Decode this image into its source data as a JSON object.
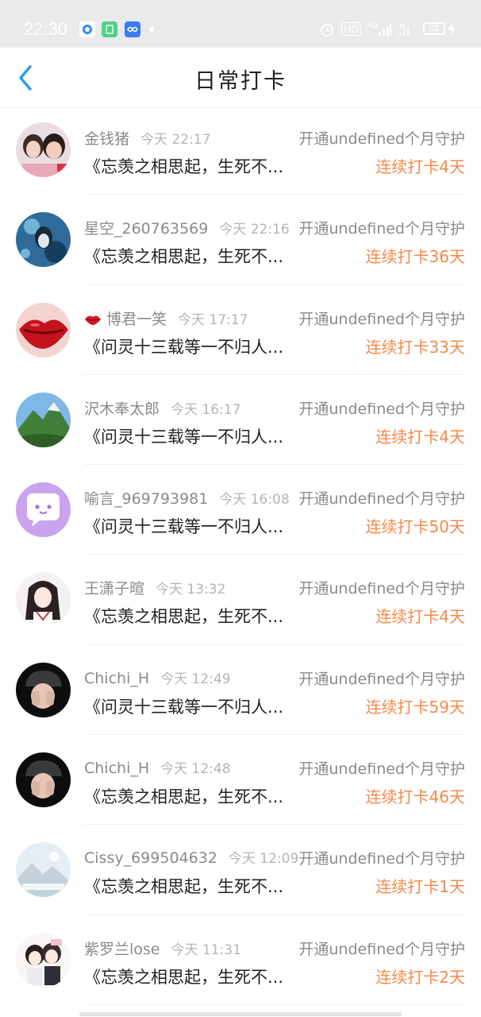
{
  "status_bar": {
    "time": "22:30",
    "hd_label": "HD",
    "network_label": "4G",
    "battery": "52"
  },
  "header": {
    "title": "日常打卡"
  },
  "colors": {
    "accent": "#2f9bf0",
    "streak": "#f5894a",
    "muted_text": "#8a8a8a"
  },
  "entries": [
    {
      "name": "金钱猪",
      "time": "今天 22:17",
      "guard": "开通undefined个月守护",
      "song": "《忘羡之相思起，生死不...",
      "streak": "连续打卡4天",
      "avatar": "photo-two-girls"
    },
    {
      "name": "星空_260763569",
      "time": "今天 22:16",
      "guard": "开通undefined个月守护",
      "song": "《忘羡之相思起，生死不...",
      "streak": "连续打卡36天",
      "avatar": "anime-blue"
    },
    {
      "name": "博君一笑",
      "time": "今天 17:17",
      "guard": "开通undefined个月守护",
      "song": "《问灵十三载等一不归人...",
      "streak": "连续打卡33天",
      "avatar": "red-lips",
      "name_icon": "lips-icon"
    },
    {
      "name": "沢木奉太郎",
      "time": "今天 16:17",
      "guard": "开通undefined个月守护",
      "song": "《问灵十三载等一不归人...",
      "streak": "连续打卡4天",
      "avatar": "mountain-landscape"
    },
    {
      "name": "喻言_969793981",
      "time": "今天 16:08",
      "guard": "开通undefined个月守护",
      "song": "《问灵十三载等一不归人...",
      "streak": "连续打卡50天",
      "avatar": "purple-chat-face"
    },
    {
      "name": "王潇子暄",
      "time": "今天 13:32",
      "guard": "开通undefined个月守护",
      "song": "《忘羡之相思起，生死不...",
      "streak": "连续打卡4天",
      "avatar": "anime-girl-dark-hair"
    },
    {
      "name": "Chichi_H",
      "time": "今天 12:49",
      "guard": "开通undefined个月守护",
      "song": "《问灵十三载等一不归人...",
      "streak": "连续打卡59天",
      "avatar": "dark-girl-face"
    },
    {
      "name": "Chichi_H",
      "time": "今天 12:48",
      "guard": "开通undefined个月守护",
      "song": "《忘羡之相思起，生死不...",
      "streak": "连续打卡46天",
      "avatar": "dark-girl-face"
    },
    {
      "name": "Cissy_699504632",
      "time": "今天 12:09",
      "guard": "开通undefined个月守护",
      "song": "《忘羡之相思起，生死不...",
      "streak": "连续打卡1天",
      "avatar": "pale-landscape"
    },
    {
      "name": "紫罗兰lose",
      "time": "今天 11:31",
      "guard": "开通undefined个月守护",
      "song": "《忘羡之相思起，生死不...",
      "streak": "连续打卡2天",
      "avatar": "chibi-couple"
    }
  ]
}
